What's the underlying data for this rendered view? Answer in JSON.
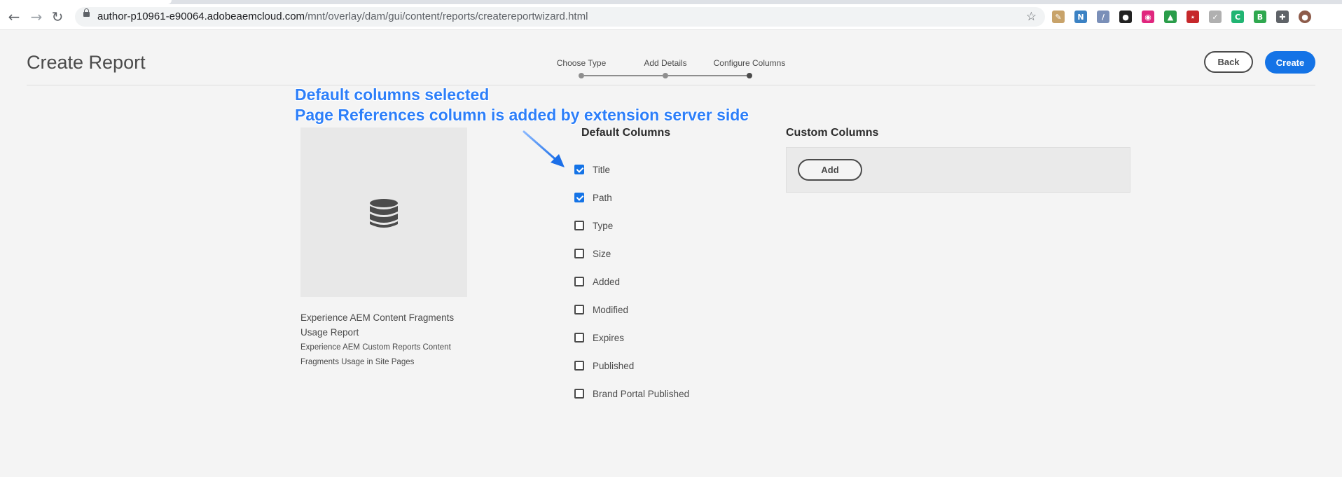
{
  "browser": {
    "url_host": "author-p10961-e90064.adobeaemcloud.com",
    "url_path": "/mnt/overlay/dam/gui/content/reports/createreportwizard.html",
    "back_icon": "arrow-left-icon",
    "forward_icon": "arrow-right-icon",
    "reload_icon": "reload-icon",
    "star_icon": "star-icon",
    "extensions": [
      {
        "name": "pen-extension-icon",
        "color": "#c8a36a",
        "glyph": "✎"
      },
      {
        "name": "n-extension-icon",
        "color": "#3b82c4",
        "glyph": "N"
      },
      {
        "name": "slash-extension-icon",
        "color": "#7a8fb8",
        "glyph": "/"
      },
      {
        "name": "incognito-extension-icon",
        "color": "#222222",
        "glyph": "●"
      },
      {
        "name": "eye-extension-icon",
        "color": "#e0267e",
        "glyph": "◉"
      },
      {
        "name": "drive-extension-icon",
        "color": "#2a9d4a",
        "glyph": "▲"
      },
      {
        "name": "red-square-extension-icon",
        "color": "#c6282b",
        "glyph": "⋆"
      },
      {
        "name": "feather-extension-icon",
        "color": "#b0b0b0",
        "glyph": "✓"
      },
      {
        "name": "c-extension-icon",
        "color": "#21b573",
        "glyph": "C"
      },
      {
        "name": "b-extension-icon",
        "color": "#2fa84f",
        "glyph": "B"
      },
      {
        "name": "puzzle-extension-icon",
        "color": "#5f6368",
        "glyph": "✚"
      },
      {
        "name": "avatar-icon",
        "color": "#8d5b4a",
        "glyph": "●"
      }
    ]
  },
  "header": {
    "title": "Create Report",
    "back_label": "Back",
    "create_label": "Create",
    "steps": [
      {
        "label": "Choose Type",
        "state": "done"
      },
      {
        "label": "Add Details",
        "state": "done"
      },
      {
        "label": "Configure Columns",
        "state": "active"
      }
    ]
  },
  "annotation": {
    "line1": "Default columns selected",
    "line2": "Page References column is added by extension server side",
    "color": "#2d7ff9"
  },
  "card": {
    "icon": "database-icon",
    "title_line1": "Experience AEM Content Fragments",
    "title_line2": "Usage Report",
    "desc_line1": "Experience AEM Custom Reports Content",
    "desc_line2": "Fragments Usage in Site Pages"
  },
  "default_columns": {
    "heading": "Default Columns",
    "items": [
      {
        "label": "Title",
        "checked": true
      },
      {
        "label": "Path",
        "checked": true
      },
      {
        "label": "Type",
        "checked": false
      },
      {
        "label": "Size",
        "checked": false
      },
      {
        "label": "Added",
        "checked": false
      },
      {
        "label": "Modified",
        "checked": false
      },
      {
        "label": "Expires",
        "checked": false
      },
      {
        "label": "Published",
        "checked": false
      },
      {
        "label": "Brand Portal Published",
        "checked": false
      }
    ]
  },
  "custom_columns": {
    "heading": "Custom Columns",
    "add_label": "Add"
  },
  "colors": {
    "accent": "#1473e6",
    "background": "#f4f4f4"
  }
}
